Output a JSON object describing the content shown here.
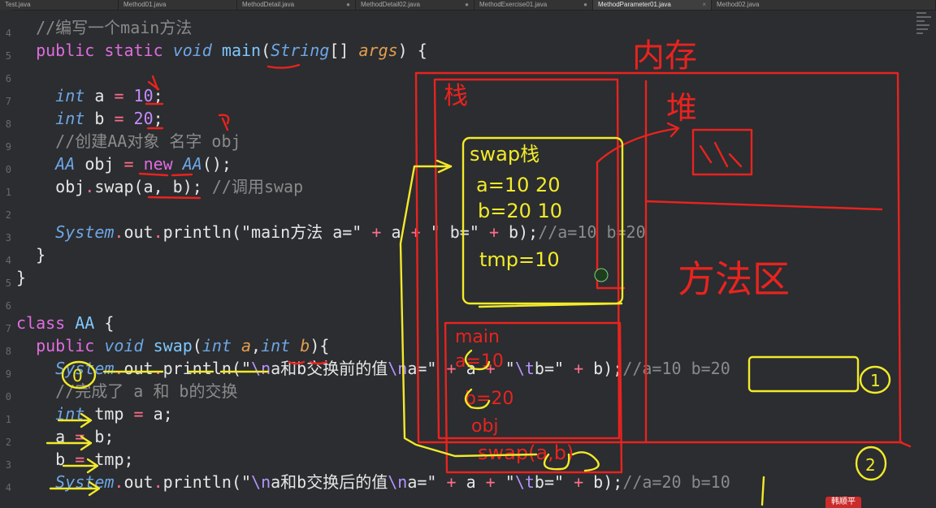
{
  "tabs": [
    {
      "label": "Test.java",
      "closable_glyph": ""
    },
    {
      "label": "Method01.java",
      "closable_glyph": ""
    },
    {
      "label": "MethodDetail.java",
      "closable_glyph": "●"
    },
    {
      "label": "MethodDetail02.java",
      "closable_glyph": "●"
    },
    {
      "label": "MethodExercise01.java",
      "closable_glyph": "●"
    },
    {
      "label": "MethodParameter01.java",
      "closable_glyph": "×"
    },
    {
      "label": "Method02.java",
      "closable_glyph": ""
    }
  ],
  "active_tab_index": 5,
  "line_numbers": [
    "4",
    "5",
    "6",
    "7",
    "8",
    "9",
    "0",
    "1",
    "2",
    "3",
    "4",
    "5",
    "6",
    "7",
    "8",
    "9",
    "0",
    "1",
    "2",
    "3",
    "4"
  ],
  "code": {
    "l1_comment": "//编写一个main方法",
    "l2_public": "public",
    "l2_static": "static",
    "l2_void": "void",
    "l2_main": "main",
    "l2_string": "String",
    "l2_args": "args",
    "l4_int": "int",
    "l4_a": "a",
    "l4_val": "10",
    "l5_int": "int",
    "l5_b": "b",
    "l5_val": "20",
    "l6_comment": "//创建AA对象 名字 obj",
    "l7_aa1": "AA",
    "l7_obj": "obj",
    "l7_new": "new",
    "l7_aa2": "AA",
    "l8_obj": "obj",
    "l8_swap": "swap",
    "l8_args": "(a, b);",
    "l8_comment": "//调用swap",
    "l10_system": "System",
    "l10_out": "out",
    "l10_println": "println",
    "l10_str1": "\"main方法 a=\"",
    "l10_a": "a",
    "l10_str2": "\" b=\"",
    "l10_b": "b",
    "l10_comment": "//a=10 b=20",
    "l13_class": "class",
    "l13_aa": "AA",
    "l14_public": "public",
    "l14_void": "void",
    "l14_swap": "swap",
    "l14_int1": "int",
    "l14_a": "a",
    "l14_int2": "int",
    "l14_b": "b",
    "l15_system": "System",
    "l15_out": "out",
    "l15_println": "println",
    "l15_str1_a": "\"",
    "l15_esc1": "\\n",
    "l15_str1_b": "a和b交换前的值",
    "l15_esc2": "\\n",
    "l15_str1_c": "a=\"",
    "l15_a": "a",
    "l15_str2_a": "\"",
    "l15_esc3": "\\t",
    "l15_str2_b": "b=\"",
    "l15_b": "b",
    "l15_comment": "//a=10 b=20",
    "l16_comment": "//完成了 a 和 b的交换",
    "l17_int": "int",
    "l17_tmp": "tmp",
    "l17_a": "a",
    "l18_a": "a",
    "l18_b": "b",
    "l19_b": "b",
    "l19_tmp": "tmp",
    "l20_system": "System",
    "l20_out": "out",
    "l20_println": "println",
    "l20_str1_a": "\"",
    "l20_esc1": "\\n",
    "l20_str1_b": "a和b交换后的值",
    "l20_esc2": "\\n",
    "l20_str1_c": "a=\"",
    "l20_a": "a",
    "l20_str2_a": "\"",
    "l20_esc3": "\\t",
    "l20_str2_b": "b=\"",
    "l20_b": "b",
    "l20_comment": "//a=20 b=10"
  },
  "annotations": {
    "memory": "内存",
    "stack": "栈",
    "heap": "堆",
    "method_area": "方法区",
    "swap_stack": "swap栈",
    "swap_a": "a=10 20",
    "swap_b": "b=20 10",
    "swap_tmp": "tmp=10",
    "main_frame": "main",
    "main_a": "a=10",
    "main_b": "b=20",
    "main_obj": "obj",
    "swap_call": "swap(a,b)",
    "mark_0": "0",
    "mark_1": "1",
    "mark_2": "2"
  },
  "badge": "韩顺平",
  "colors": {
    "ink_red": "#e8231f",
    "ink_yellow": "#f2ea2a",
    "background": "#2b2d30"
  }
}
